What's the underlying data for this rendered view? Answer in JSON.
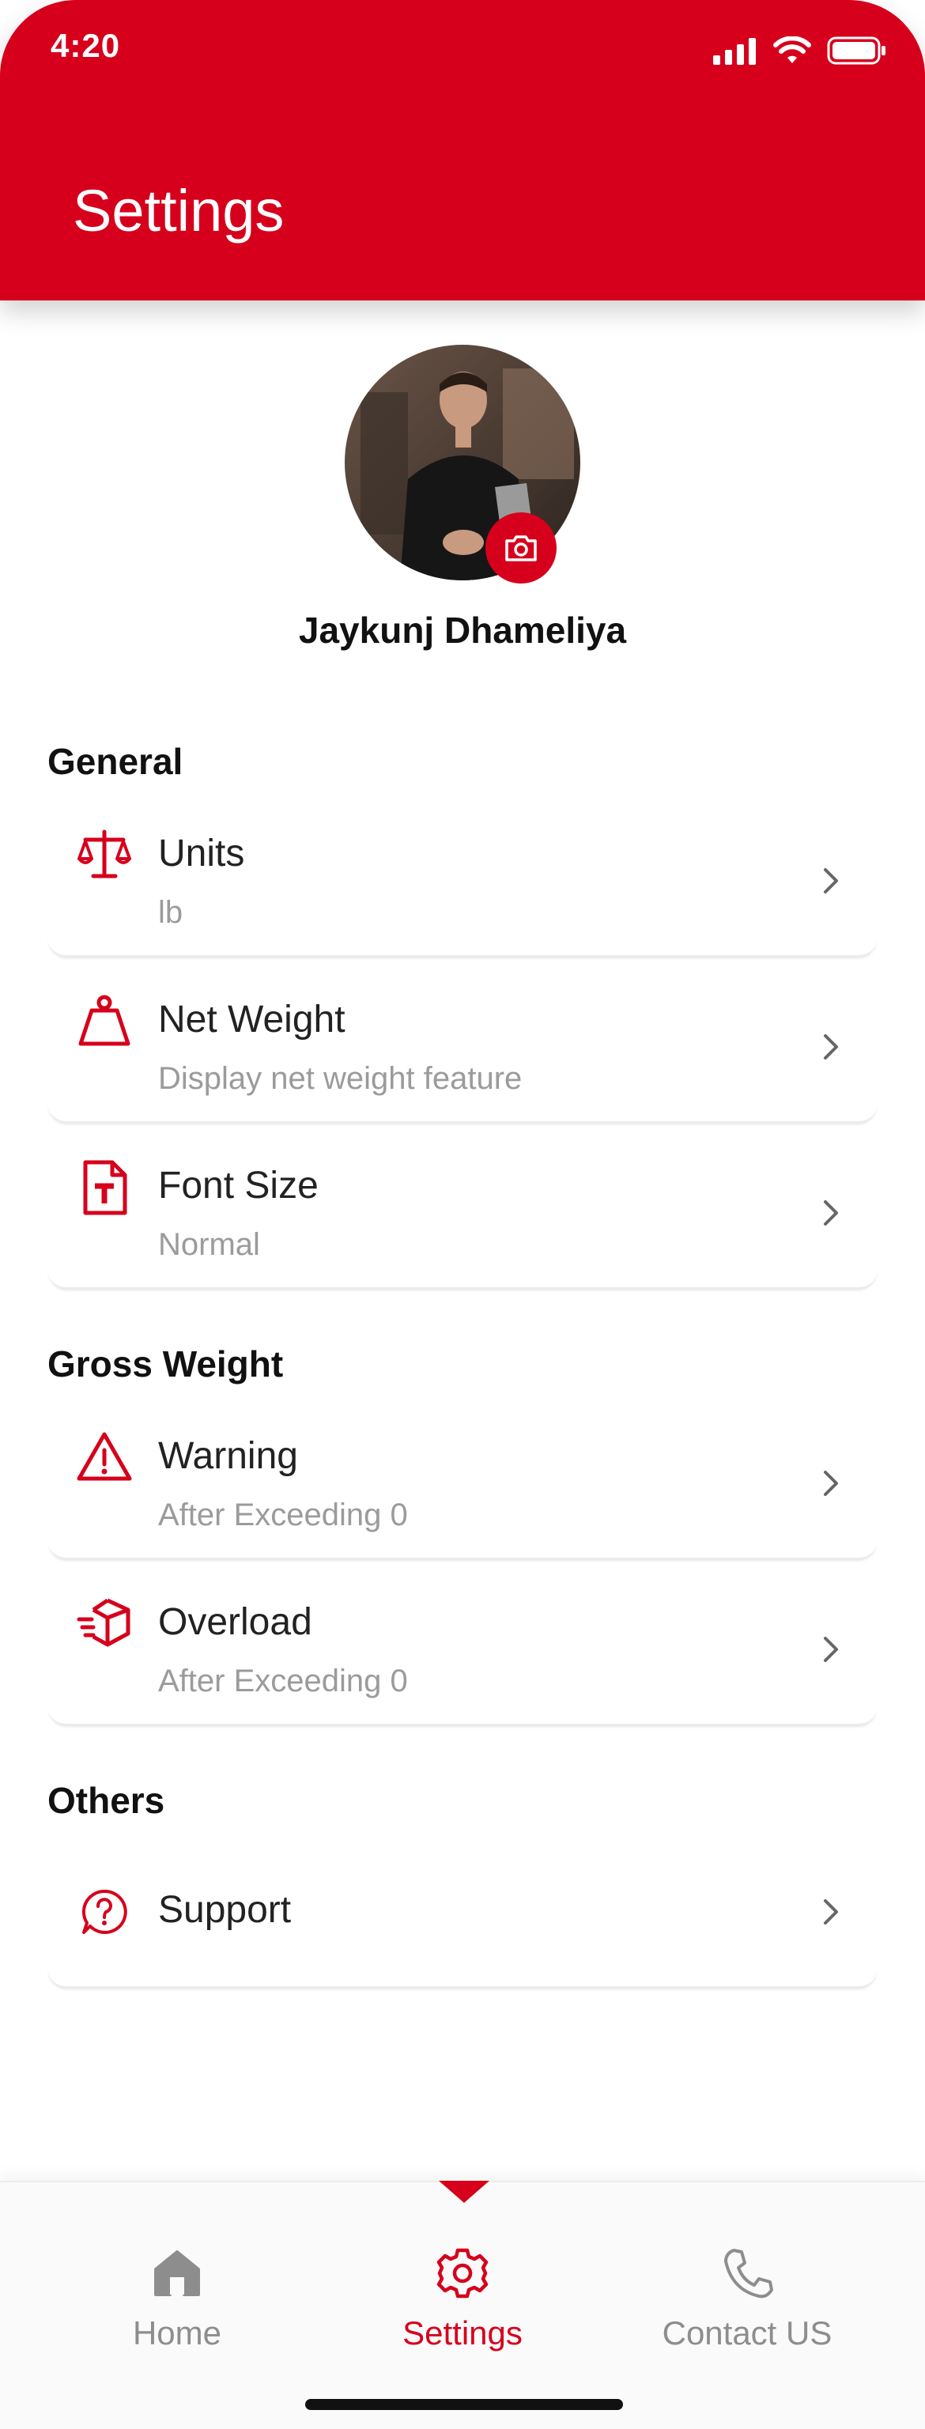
{
  "status_bar": {
    "time": "4:20"
  },
  "header": {
    "title": "Settings"
  },
  "profile": {
    "name": "Jaykunj Dhameliya"
  },
  "sections": {
    "general": {
      "title": "General",
      "items": [
        {
          "label": "Units",
          "sub": "lb",
          "icon": "scale-icon"
        },
        {
          "label": "Net Weight",
          "sub": "Display net weight feature",
          "icon": "weight-icon"
        },
        {
          "label": "Font Size",
          "sub": "Normal",
          "icon": "font-file-icon"
        }
      ]
    },
    "gross_weight": {
      "title": "Gross Weight",
      "items": [
        {
          "label": "Warning",
          "sub": "After Exceeding 0",
          "icon": "warning-icon"
        },
        {
          "label": "Overload",
          "sub": "After Exceeding 0",
          "icon": "fast-box-icon"
        }
      ]
    },
    "others": {
      "title": "Others",
      "items": [
        {
          "label": "Support",
          "icon": "help-circle-icon"
        }
      ]
    }
  },
  "bottom_nav": {
    "items": [
      {
        "label": "Home",
        "icon": "home-icon",
        "active": false
      },
      {
        "label": "Settings",
        "icon": "gear-icon",
        "active": true
      },
      {
        "label": "Contact US",
        "icon": "phone-icon",
        "active": false
      }
    ]
  },
  "colors": {
    "brand_red": "#d6001c",
    "text_dark": "#222222",
    "text_muted": "#9b9b9b",
    "nav_inactive": "#8d8d8d"
  }
}
